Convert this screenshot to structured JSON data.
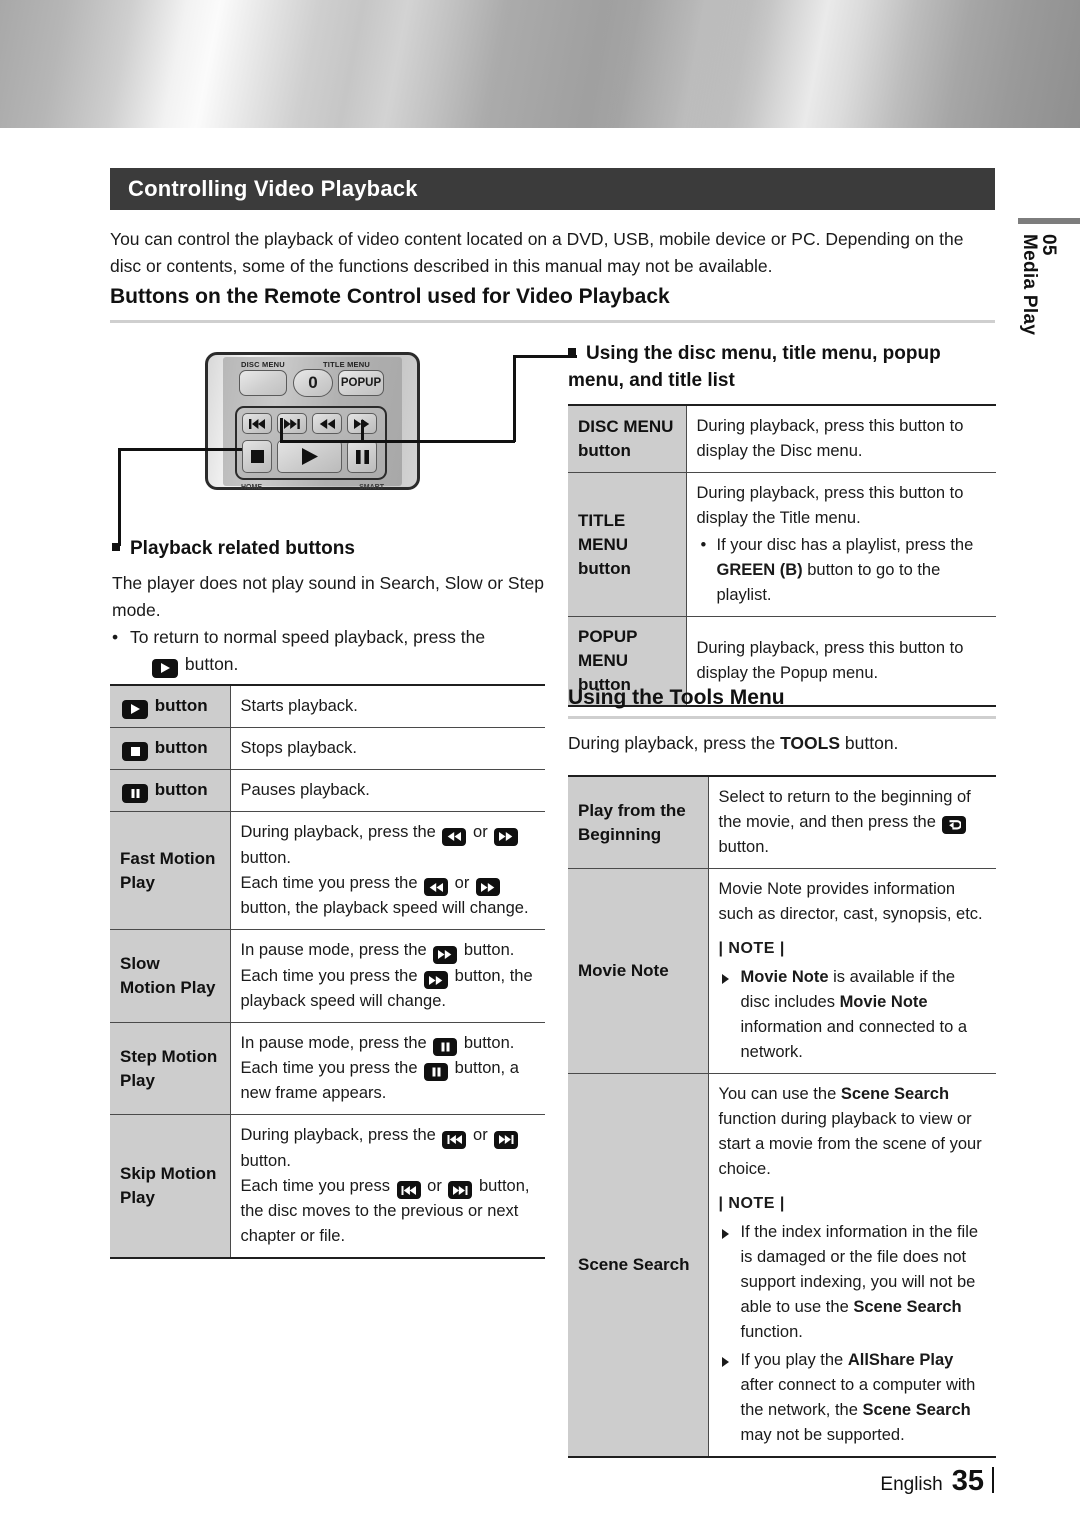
{
  "document": {
    "section_number": "05",
    "section_name": "Media Play",
    "footer_language": "English",
    "footer_page": "35"
  },
  "header": {
    "title": "Controlling Video Playback",
    "intro": "You can control the playback of video content located on a DVD, USB, mobile device or PC. Depending on the disc or contents, some of the functions described in this manual may not be available.",
    "subheading": "Buttons on the Remote Control used for Video Playback"
  },
  "remote": {
    "label_disc_menu": "DISC MENU",
    "label_title_menu": "TITLE MENU",
    "key_zero": "0",
    "key_popup": "POPUP",
    "key_disc": "",
    "bottom_left": "HOME",
    "bottom_right": "SMART"
  },
  "left_column": {
    "bullet_heading": "Playback related buttons",
    "paragraph": "The player does not play sound in Search, Slow or Step mode.",
    "bullet_item_pre": "To return to normal speed playback, press the",
    "bullet_item_post": "button.",
    "table_rows": [
      {
        "key_prefix": "",
        "key_icon": "play-icon",
        "key_suffix": "button",
        "desc": "Starts playback."
      },
      {
        "key_prefix": "",
        "key_icon": "stop-icon",
        "key_suffix": "button",
        "desc": "Stops playback."
      },
      {
        "key_prefix": "",
        "key_icon": "pause-icon",
        "key_suffix": "button",
        "desc": "Pauses playback."
      },
      {
        "key_text": "Fast Motion Play",
        "lines": [
          "During playback, press the {rew} or {ff} button.",
          "Each time you press the {rew} or {ff} button, the playback speed will change."
        ]
      },
      {
        "key_text": "Slow Motion Play",
        "lines": [
          "In pause mode, press the {ff} button.",
          "Each time you press the {ff} button, the playback speed will change."
        ]
      },
      {
        "key_text": "Step Motion Play",
        "lines": [
          "In pause mode, press the {pause} button.",
          "Each time you press the {pause} button, a new frame appears."
        ]
      },
      {
        "key_text": "Skip Motion Play",
        "lines": [
          "During playback, press the {prev} or {next} button.",
          "Each time you press {prev} or {next} button, the disc moves to the previous or next chapter or file."
        ]
      }
    ]
  },
  "right_column": {
    "bullet_heading": "Using the disc menu, title menu, popup menu, and title list",
    "menu_table": [
      {
        "key": "DISC MENU button",
        "key_line1": "DISC MENU",
        "key_line2": "button",
        "desc": "During playback, press this button to display the Disc menu."
      },
      {
        "key": "TITLE MENU button",
        "key_line1": "TITLE MENU",
        "key_line2": "button",
        "desc": "During playback, press this button to display the Title menu.",
        "bullet": "If your disc has a playlist, press the GREEN (B) button to go to the playlist.",
        "bullet_pre": "If your disc has a playlist, press the ",
        "bullet_bold": "GREEN (B)",
        "bullet_post": " button to go to the playlist."
      },
      {
        "key": "POPUP MENU button",
        "key_line1": "POPUP MENU",
        "key_line2": "button",
        "desc": "During playback, press this button to display the Popup menu."
      }
    ],
    "tools_heading": "Using the Tools Menu",
    "tools_intro_pre": "During playback, press the ",
    "tools_intro_bold": "TOOLS",
    "tools_intro_post": " button.",
    "tools_table": [
      {
        "key_line1": "Play from the",
        "key_line2": "Beginning",
        "desc_pre": "Select to return to the beginning of the movie, and then press the ",
        "desc_icon": "enter-icon",
        "desc_post": " button."
      },
      {
        "key_line1": "Movie Note",
        "key_line2": "",
        "desc": "Movie Note provides information such as director, cast, synopsis, etc.",
        "note_label": "| NOTE |",
        "notes": [
          {
            "parts": [
              {
                "t": "Movie Note",
                "b": true
              },
              {
                "t": " is available if the disc includes ",
                "b": false
              },
              {
                "t": "Movie Note",
                "b": true
              },
              {
                "t": " information and connected to a network.",
                "b": false
              }
            ]
          }
        ]
      },
      {
        "key_line1": "Scene Search",
        "key_line2": "",
        "desc_parts": [
          {
            "t": "You can use the ",
            "b": false
          },
          {
            "t": "Scene Search",
            "b": true
          },
          {
            "t": " function during playback to view or start a movie from the scene of your choice.",
            "b": false
          }
        ],
        "note_label": "| NOTE |",
        "notes": [
          {
            "parts": [
              {
                "t": "If the index information in the file is damaged or the file does not support indexing, you will not be able to use the ",
                "b": false
              },
              {
                "t": "Scene Search",
                "b": true
              },
              {
                "t": " function.",
                "b": false
              }
            ]
          },
          {
            "parts": [
              {
                "t": "If you play the ",
                "b": false
              },
              {
                "t": "AllShare Play",
                "b": true
              },
              {
                "t": " after connect to a computer with the network, the ",
                "b": false
              },
              {
                "t": "Scene Search",
                "b": true
              },
              {
                "t": " may not be supported.",
                "b": false
              }
            ]
          }
        ]
      }
    ]
  }
}
